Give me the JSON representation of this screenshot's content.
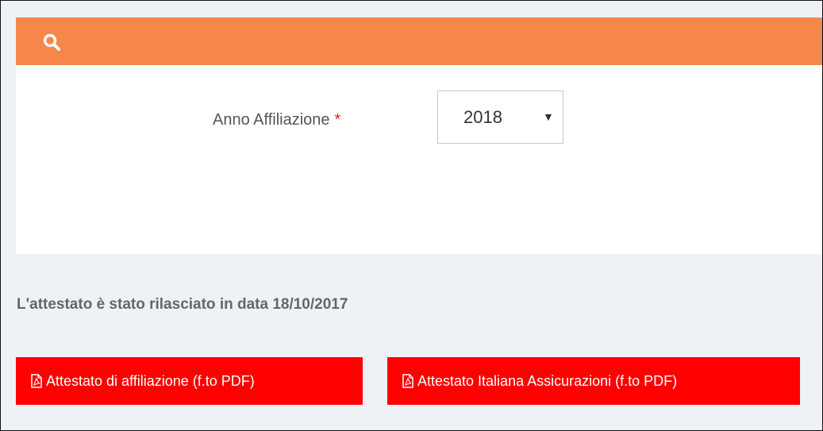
{
  "filter_panel": {
    "search_icon": "search-icon",
    "year_field": {
      "label": "Anno Affiliazione",
      "required_marker": "*",
      "selected_value": "2018",
      "arrow": "▼"
    }
  },
  "notice": {
    "text": "L'attestato è stato rilasciato in data 18/10/2017"
  },
  "buttons": [
    {
      "label": "Attestato di affiliazione (f.to PDF)",
      "icon": "file-pdf-icon"
    },
    {
      "label": "Attestato Italiana Assicurazioni (f.to PDF)",
      "icon": "file-pdf-icon"
    }
  ],
  "colors": {
    "header": "#f5874b",
    "button": "#ff0000",
    "background": "#eef1f5",
    "required": "#e02222"
  }
}
